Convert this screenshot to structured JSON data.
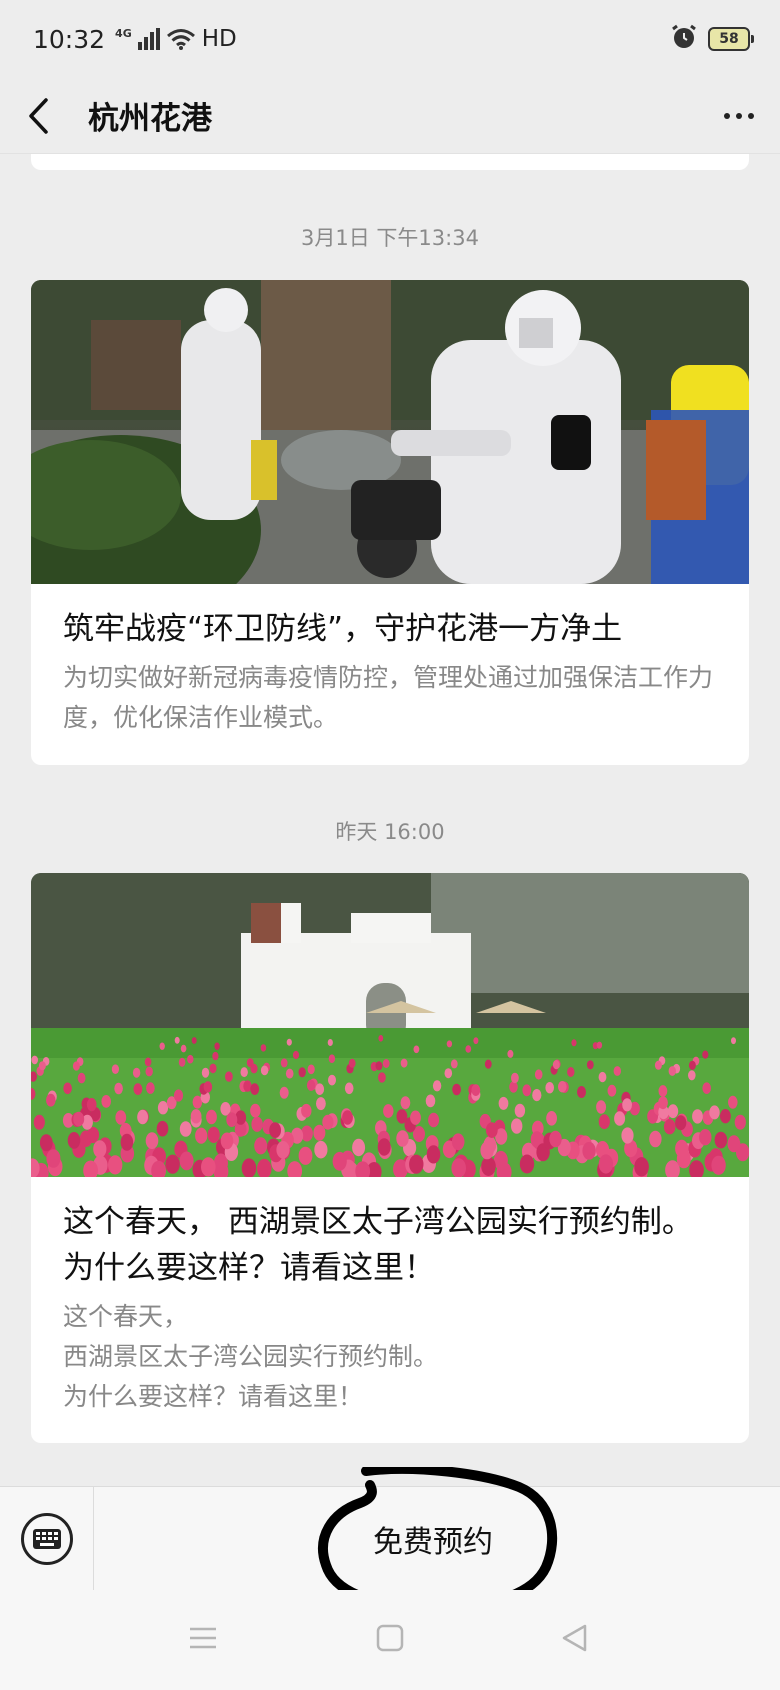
{
  "status_bar": {
    "time": "10:32",
    "network": "4G",
    "hd_label": "HD",
    "battery": "58",
    "icons": [
      "signal-icon",
      "wifi-icon",
      "alarm-icon",
      "battery-icon"
    ]
  },
  "header": {
    "title": "杭州花港",
    "icons": [
      "back-arrow-icon",
      "more-dots-icon"
    ]
  },
  "feed": {
    "articles": [
      {
        "timestamp": "3月1日 下午13:34",
        "title": "筑牢战疫“环卫防线”，守护花港一方净土",
        "description": "为切实做好新冠病毒疫情防控，管理处通过加强保洁工作力度，优化保洁作业模式。",
        "image": "workers-in-protective-suits-disinfecting-photo"
      },
      {
        "timestamp": "昨天 16:00",
        "title": "这个春天， 西湖景区太子湾公园实行预约制。 为什么要这样？请看这里！",
        "description_lines": [
          "这个春天，",
          "西湖景区太子湾公园实行预约制。",
          "为什么要这样？请看这里！"
        ],
        "image": "tulip-garden-with-white-building-photo"
      }
    ]
  },
  "bottom_menu": {
    "items": [
      {
        "label": "免费预约"
      }
    ],
    "icons": [
      "keyboard-icon"
    ]
  },
  "nav_bar": {
    "icons": [
      "menu-lines-icon",
      "home-square-icon",
      "back-triangle-icon"
    ]
  },
  "colors": {
    "background": "#ededed",
    "card": "#ffffff",
    "timestamp": "#8a8a8a",
    "description": "#888888",
    "scribble": "#000000"
  }
}
